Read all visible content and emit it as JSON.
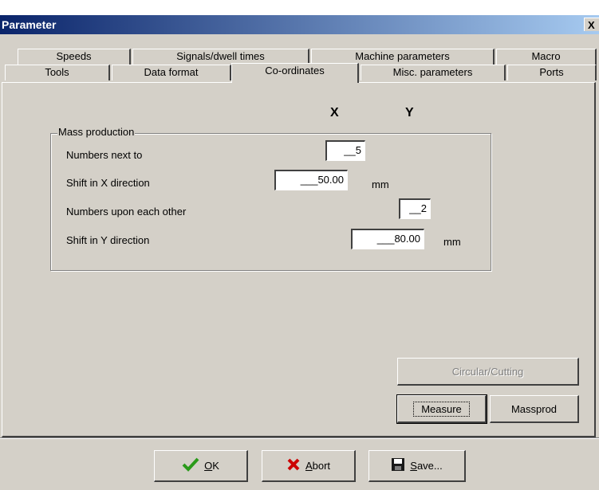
{
  "window": {
    "title": "Parameter",
    "close_glyph": "X"
  },
  "tabs": {
    "row_back": [
      {
        "label": "Speeds"
      },
      {
        "label": "Signals/dwell times"
      },
      {
        "label": "Machine parameters"
      },
      {
        "label": "Macro"
      }
    ],
    "row_front": [
      {
        "label": "Tools"
      },
      {
        "label": "Data format"
      },
      {
        "label": "Co-ordinates",
        "active": true
      },
      {
        "label": "Misc. parameters"
      },
      {
        "label": "Ports"
      }
    ]
  },
  "columns": {
    "x": "X",
    "y": "Y"
  },
  "mass_production": {
    "group_label": "Mass production",
    "rows": [
      {
        "label": "Numbers next to",
        "value": "__5",
        "unit": ""
      },
      {
        "label": "Shift in X direction",
        "value": "___50.00",
        "unit": "mm"
      },
      {
        "label": "Numbers upon each other",
        "value": "__2",
        "unit": ""
      },
      {
        "label": "Shift in Y direction",
        "value": "___80.00",
        "unit": "mm"
      }
    ]
  },
  "side_buttons": {
    "circular_cutting": "Circular/Cutting",
    "measure": "Measure",
    "massprod": "Massprod"
  },
  "footer": {
    "ok_mnemonic": "O",
    "ok_rest": "K",
    "abort_mnemonic": "A",
    "abort_rest": "bort",
    "save_mnemonic": "S",
    "save_rest": "ave..."
  },
  "colors": {
    "title_start": "#0a246a",
    "title_end": "#a6caf0",
    "face": "#d4d0c8",
    "ok_check": "#2a9a1a",
    "abort_x": "#cc0000"
  },
  "icons": {
    "ok": "checkmark-icon",
    "abort": "red-x-icon",
    "save": "floppy-disk-icon"
  }
}
